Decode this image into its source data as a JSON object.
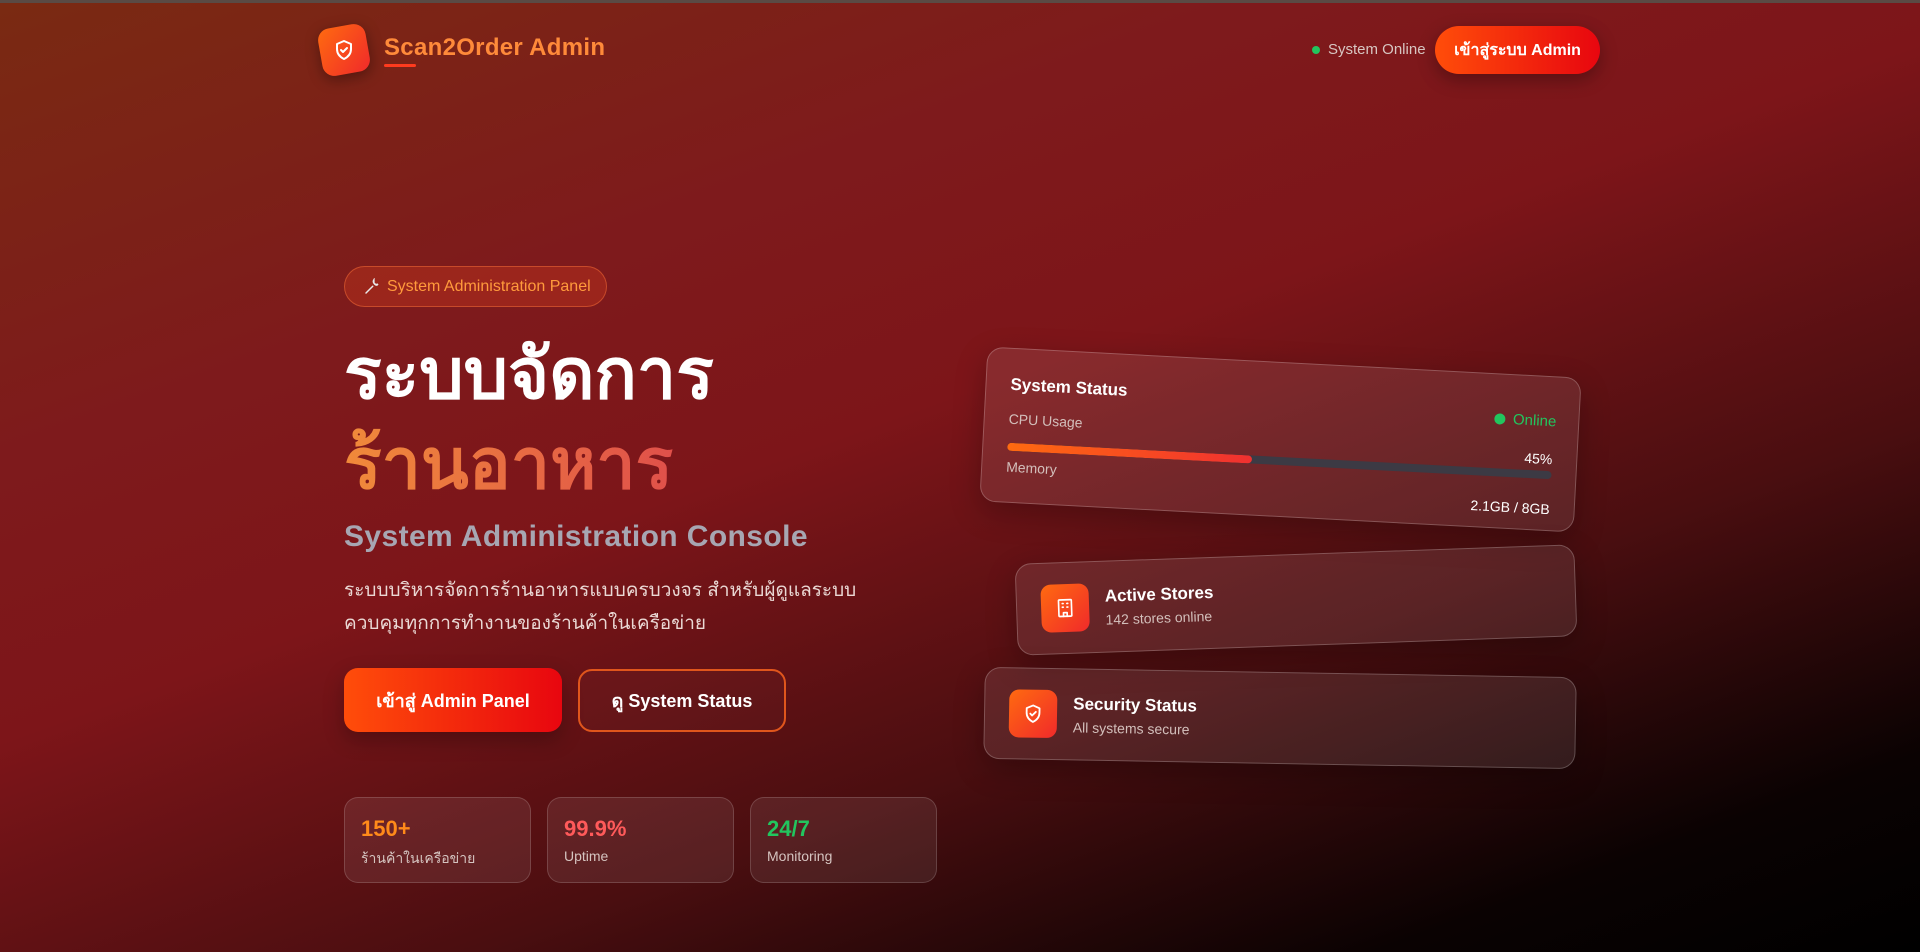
{
  "header": {
    "brand": "Scan2Order Admin",
    "status_text": "System Online",
    "login_button": "เข้าสู่ระบบ Admin"
  },
  "hero": {
    "badge_icon": "wrench-icon",
    "badge_text": "System Administration Panel",
    "title_line1": "ระบบจัดการ",
    "title_line2": "ร้านอาหาร",
    "subtitle": "System Administration Console",
    "description_line1": "ระบบบริหารจัดการร้านอาหารแบบครบวงจร สำหรับผู้ดูแลระบบ",
    "description_line2": "ควบคุมทุกการทำงานของร้านค้าในเครือข่าย",
    "primary_button": "เข้าสู่ Admin Panel",
    "secondary_button": "ดู System Status"
  },
  "stats": [
    {
      "value": "150+",
      "label": "ร้านค้าในเครือข่าย",
      "color": "#ff8a1a"
    },
    {
      "value": "99.9%",
      "label": "Uptime",
      "color": "#ff5a5a"
    },
    {
      "value": "24/7",
      "label": "Monitoring",
      "color": "#22c55e"
    }
  ],
  "system_status": {
    "title": "System Status",
    "status": "Online",
    "cpu_label": "CPU Usage",
    "cpu_value": "45%",
    "cpu_fraction": 0.45,
    "memory_label": "Memory",
    "memory_value": "2.1GB / 8GB"
  },
  "active_stores": {
    "icon": "building-icon",
    "title": "Active Stores",
    "subtitle": "142 stores online"
  },
  "security": {
    "icon": "shield-check-icon",
    "title": "Security Status",
    "subtitle": "All systems secure"
  },
  "colors": {
    "accent": "#ff4d0a",
    "accent_red": "#e8060f",
    "online_green": "#22c55e"
  }
}
